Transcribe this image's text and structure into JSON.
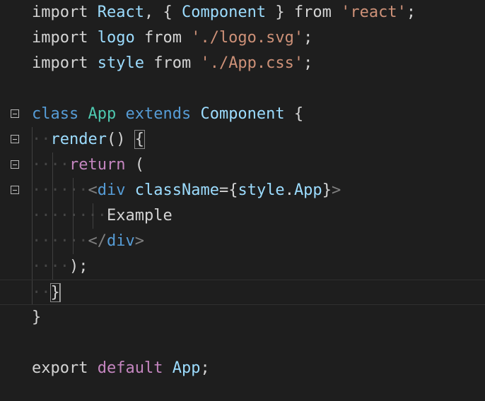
{
  "editor": {
    "lines": {
      "l1": {
        "t1": "import",
        "t2": " ",
        "t3": "React",
        "t4": ", { ",
        "t5": "Component",
        "t6": " } ",
        "t7": "from",
        "t8": " ",
        "t9": "'react'",
        "t10": ";"
      },
      "l2": {
        "t1": "import",
        "t2": " ",
        "t3": "logo",
        "t4": " ",
        "t5": "from",
        "t6": " ",
        "t7": "'./logo.svg'",
        "t8": ";"
      },
      "l3": {
        "t1": "import",
        "t2": " ",
        "t3": "style",
        "t4": " ",
        "t5": "from",
        "t6": " ",
        "t7": "'./App.css'",
        "t8": ";"
      },
      "l5": {
        "t1": "class",
        "t2": " ",
        "t3": "App",
        "t4": " ",
        "t5": "extends",
        "t6": " ",
        "t7": "Component",
        "t8": " {"
      },
      "l6": {
        "ws": "··",
        "t1": "render",
        "t2": "() ",
        "t3": "{"
      },
      "l7": {
        "ws": "····",
        "t1": "return",
        "t2": " ("
      },
      "l8": {
        "ws": "······",
        "t1": "<",
        "t2": "div",
        "t3": " ",
        "t4": "className",
        "t5": "={",
        "t6": "style",
        "t7": ".",
        "t8": "App",
        "t9": "}",
        "t10": ">"
      },
      "l9": {
        "ws": "········",
        "t1": "Example"
      },
      "l10": {
        "ws": "······",
        "t1": "</",
        "t2": "div",
        "t3": ">"
      },
      "l11": {
        "ws": "····",
        "t1": ");"
      },
      "l12": {
        "ws": "··",
        "t1": "}"
      },
      "l13": {
        "t1": "}"
      },
      "l15": {
        "t1": "export",
        "t2": " ",
        "t3": "default",
        "t4": " ",
        "t5": "App",
        "t6": ";"
      }
    }
  }
}
